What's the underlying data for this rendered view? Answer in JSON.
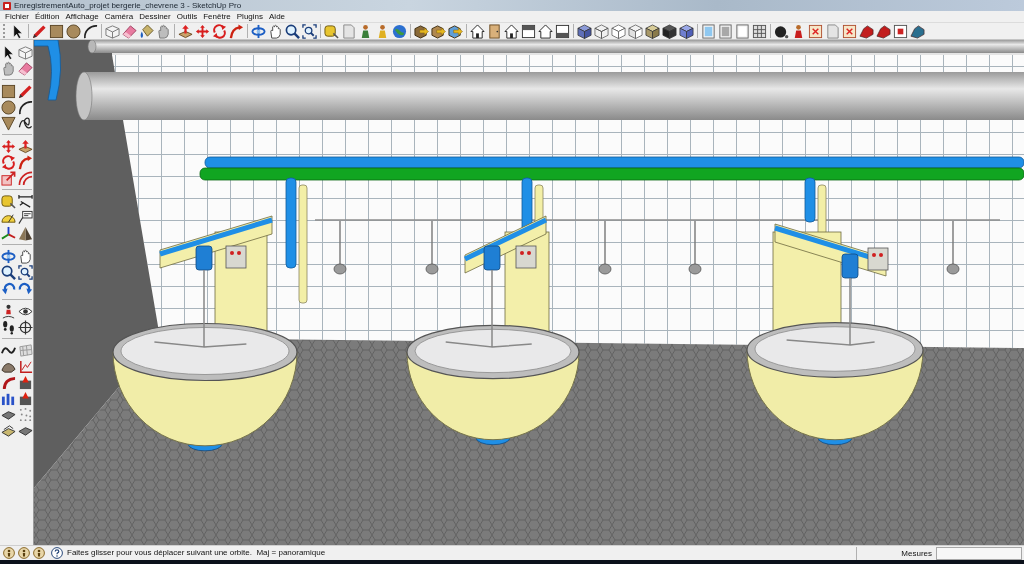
{
  "window": {
    "title": "EnregistrementAuto_projet bergerie_chevrene 3 - SketchUp Pro"
  },
  "menu_bar": {
    "items": [
      "Fichier",
      "Édition",
      "Affichage",
      "Caméra",
      "Dessiner",
      "Outils",
      "Fenêtre",
      "Plugins",
      "Aide"
    ]
  },
  "status_bar": {
    "hint": "Faites glisser pour vous déplacer suivant une orbite.  Maj = panoramique",
    "measurements_label": "Mesures"
  }
}
